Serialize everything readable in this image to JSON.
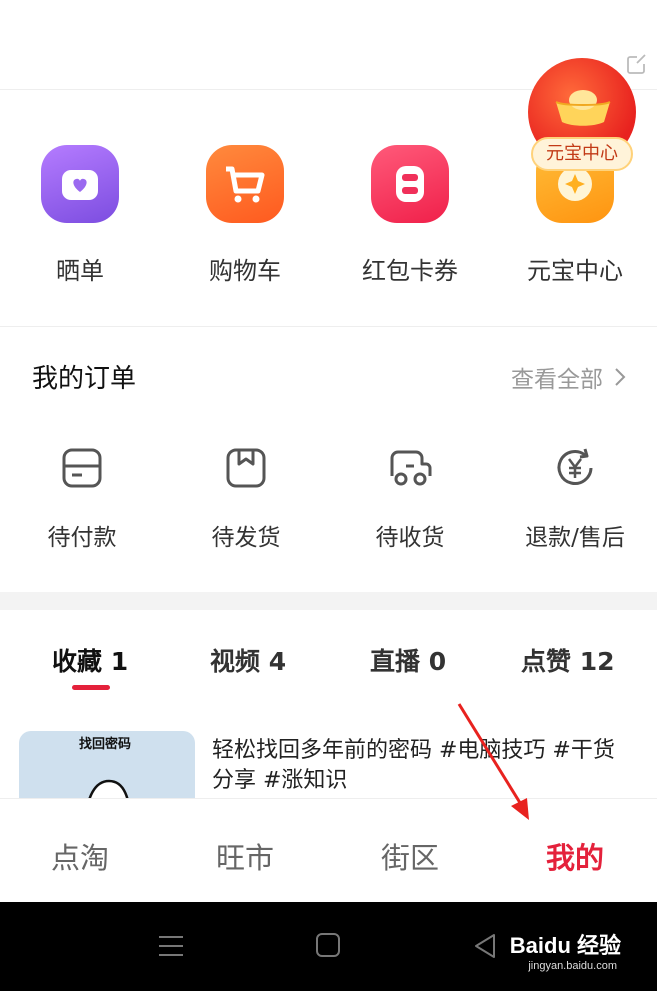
{
  "quick_actions": [
    {
      "label": "晒单",
      "icon": "share-order-icon",
      "color": "#8e5cf0"
    },
    {
      "label": "购物车",
      "icon": "cart-icon",
      "color": "#ff6a2a"
    },
    {
      "label": "红包卡券",
      "icon": "coupon-icon",
      "color": "#ff3b5c"
    },
    {
      "label": "元宝中心",
      "icon": "ingot-center-icon",
      "color": "#ffa21a"
    }
  ],
  "ingot_badge": {
    "label": "元宝中心"
  },
  "orders": {
    "title": "我的订单",
    "view_all": "查看全部",
    "items": [
      {
        "label": "待付款",
        "icon": "wallet-icon"
      },
      {
        "label": "待发货",
        "icon": "package-icon"
      },
      {
        "label": "待收货",
        "icon": "truck-icon"
      },
      {
        "label": "退款/售后",
        "icon": "refund-icon"
      }
    ]
  },
  "content_tabs": [
    {
      "label": "收藏 1",
      "active": true
    },
    {
      "label": "视频 4",
      "active": false
    },
    {
      "label": "直播 0",
      "active": false
    },
    {
      "label": "点赞 12",
      "active": false
    }
  ],
  "feed": {
    "thumb_text": "找回密码",
    "title": "轻松找回多年前的密码 #电脑技巧 #干货分享 #涨知识"
  },
  "tabbar": [
    {
      "label": "点淘",
      "active": false
    },
    {
      "label": "旺市",
      "active": false
    },
    {
      "label": "街区",
      "active": false
    },
    {
      "label": "我的",
      "active": true
    }
  ],
  "watermark": {
    "brand": "Baidu 经验",
    "url": "jingyan.baidu.com"
  },
  "colors": {
    "accent": "#e4213b"
  }
}
